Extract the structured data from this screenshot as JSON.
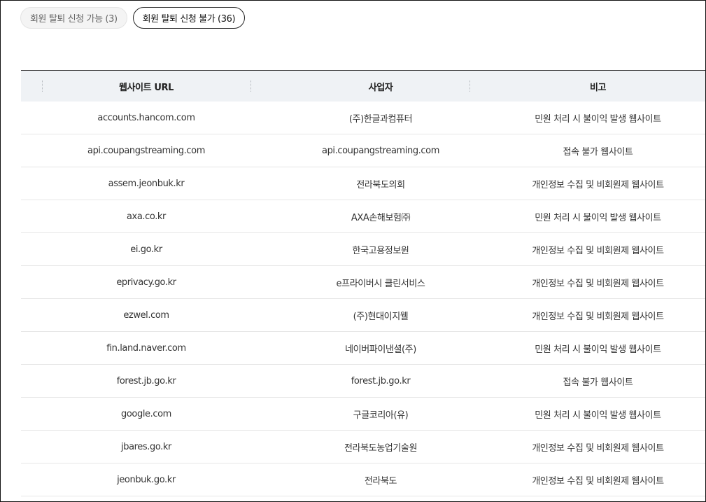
{
  "tabs": [
    {
      "label": "회원 탈퇴 신청 가능 (3)",
      "active": false
    },
    {
      "label": "회원 탈퇴 신청 불가 (36)",
      "active": true
    }
  ],
  "table": {
    "headers": [
      "웹사이트 URL",
      "사업자",
      "비고"
    ],
    "rows": [
      [
        "accounts.hancom.com",
        "(주)한글과컴퓨터",
        "민원 처리 시 불이익 발생 웹사이트"
      ],
      [
        "api.coupangstreaming.com",
        "api.coupangstreaming.com",
        "접속 불가 웹사이트"
      ],
      [
        "assem.jeonbuk.kr",
        "전라북도의회",
        "개인정보 수집 및 비회원제 웹사이트"
      ],
      [
        "axa.co.kr",
        "AXA손해보험㈜",
        "민원 처리 시 불이익 발생 웹사이트"
      ],
      [
        "ei.go.kr",
        "한국고용정보원",
        "개인정보 수집 및 비회원제 웹사이트"
      ],
      [
        "eprivacy.go.kr",
        "e프라이버시 클린서비스",
        "개인정보 수집 및 비회원제 웹사이트"
      ],
      [
        "ezwel.com",
        "(주)현대이지웰",
        "개인정보 수집 및 비회원제 웹사이트"
      ],
      [
        "fin.land.naver.com",
        "네이버파이낸셜(주)",
        "민원 처리 시 불이익 발생 웹사이트"
      ],
      [
        "forest.jb.go.kr",
        "forest.jb.go.kr",
        "접속 불가 웹사이트"
      ],
      [
        "google.com",
        "구글코리아(유)",
        "민원 처리 시 불이익 발생 웹사이트"
      ],
      [
        "jbares.go.kr",
        "전라북도농업기술원",
        "개인정보 수집 및 비회원제 웹사이트"
      ],
      [
        "jeonbuk.go.kr",
        "전라북도",
        "개인정보 수집 및 비회원제 웹사이트"
      ]
    ]
  }
}
